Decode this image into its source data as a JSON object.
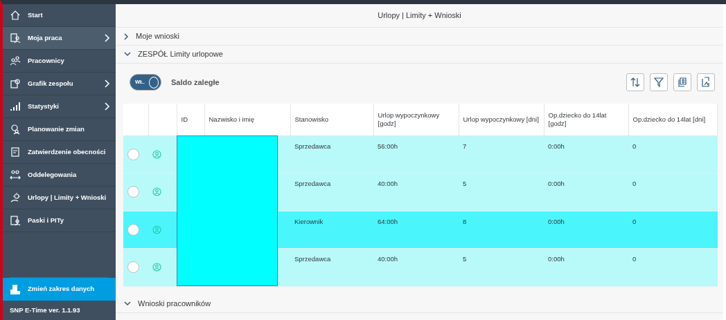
{
  "sidebar": {
    "items": [
      {
        "label": "Start",
        "has_submenu": false,
        "selected": false
      },
      {
        "label": "Moja praca",
        "has_submenu": true,
        "selected": true
      },
      {
        "label": "Pracownicy",
        "has_submenu": false,
        "selected": false
      },
      {
        "label": "Grafik zespołu",
        "has_submenu": true,
        "selected": false
      },
      {
        "label": "Statystyki",
        "has_submenu": true,
        "selected": false
      },
      {
        "label": "Planowanie zmian",
        "has_submenu": false,
        "selected": false
      },
      {
        "label": "Zatwierdzenie obecności",
        "has_submenu": false,
        "selected": false
      },
      {
        "label": "Oddelegowania",
        "has_submenu": false,
        "selected": false
      },
      {
        "label": "Urlopy | Limity + Wnioski",
        "has_submenu": false,
        "selected": false
      },
      {
        "label": "Paski i PITy",
        "has_submenu": false,
        "selected": false
      }
    ],
    "footer_button": "Zmień zakres danych",
    "version": "SNP E-Time ver. 1.1.93"
  },
  "page": {
    "title": "Urlopy | Limity + Wnioski"
  },
  "sections": [
    {
      "title": "Moje wnioski",
      "expanded": false
    },
    {
      "title": "ZESPÓŁ Limity urlopowe",
      "expanded": true
    }
  ],
  "toolbar": {
    "toggle": {
      "label": "WŁ.",
      "on": true
    },
    "title": "Saldo zaległe"
  },
  "table": {
    "columns": [
      "",
      "",
      "ID",
      "Nazwisko i imię",
      "Stanowisko",
      "Urlop wypoczynkowy [godz]",
      "Urlop wypoczynkowy [dni]",
      "Op.dziecko do 14lat [godz]",
      "Op.dziecko do 14lat [dni]"
    ],
    "rows": [
      {
        "selected": false,
        "cells": [
          "",
          "",
          "",
          "",
          "Sprzedawca",
          "56:00h",
          "7",
          "0:00h",
          "0"
        ]
      },
      {
        "selected": false,
        "cells": [
          "",
          "",
          "",
          "",
          "Sprzedawca",
          "40:00h",
          "5",
          "0:00h",
          "0"
        ]
      },
      {
        "selected": true,
        "cells": [
          "",
          "",
          "",
          "",
          "Kierownik",
          "64:00h",
          "8",
          "0:00h",
          "0"
        ]
      },
      {
        "selected": false,
        "cells": [
          "",
          "",
          "",
          "",
          "Sprzedawca",
          "40:00h",
          "5",
          "0:00h",
          "0"
        ]
      }
    ]
  },
  "bottom_section": {
    "title": "Wnioski pracowników",
    "expanded": true
  }
}
